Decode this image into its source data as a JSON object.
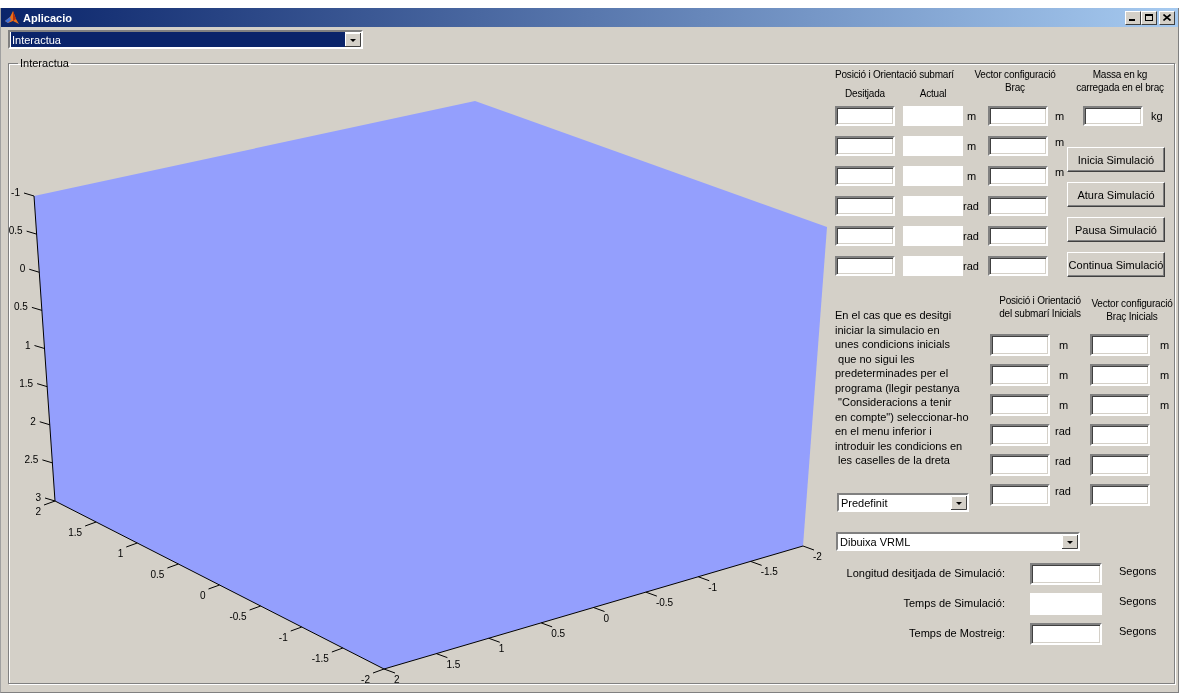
{
  "window": {
    "title": "Aplicacio"
  },
  "mode_select": {
    "value": "Interactua",
    "highlighted": true
  },
  "panel": {
    "title": "Interactua"
  },
  "plot": {
    "z_ticks": [
      "-1",
      "0.5",
      "0",
      "0.5",
      "1",
      "1.5",
      "2",
      "2.5",
      "3"
    ],
    "x_ticks": [
      "2",
      "1.5",
      "1",
      "0.5",
      "0",
      "-0.5",
      "-1",
      "-1.5",
      "-2"
    ],
    "y_ticks": [
      "2",
      "1.5",
      "1",
      "0.5",
      "0",
      "-0.5",
      "-1",
      "-1.5",
      "-2"
    ]
  },
  "target": {
    "title": "Posició i Orientació submarí",
    "columns": [
      {
        "label": "Desitjada",
        "kind": "edit"
      },
      {
        "label": "Actual",
        "kind": "display"
      }
    ],
    "units": [
      "m",
      "m",
      "m",
      "rad",
      "rad",
      "rad"
    ]
  },
  "arm": {
    "title": "Vector configuració\nBraç",
    "units": [
      "m",
      "m",
      "m"
    ]
  },
  "mass": {
    "title": "Massa en kg\ncarregada en el braç",
    "unit": "kg"
  },
  "buttons": [
    "Inicia Simulació",
    "Atura Simulació",
    "Pausa Simulació",
    "Continua Simulació"
  ],
  "initial": {
    "note": "En el cas que es desitgi\niniciar la simulacio en\nunes condicions inicials\n que no sigui les\npredeterminades per el\nprograma (llegir pestanya\n \"Consideracions a tenir\nen compte\") seleccionar-ho\nen el menu inferior i\nintroduir les condicions en\n les caselles de la dreta",
    "position_title": "Posició i Orientació\ndel submarí Inicials",
    "position_units": [
      "m",
      "m",
      "m",
      "rad",
      "rad",
      "rad"
    ],
    "arm_title": "Vector configuració\nBraç Inicials",
    "arm_units": [
      "m",
      "m",
      "m"
    ]
  },
  "preset_select": {
    "value": "Predefinit",
    "highlighted": false
  },
  "draw_select": {
    "value": "Dibuixa VRML",
    "highlighted": false
  },
  "timing": [
    {
      "label": "Longitud desitjada de Simulació:",
      "unit": "Segons",
      "kind": "edit"
    },
    {
      "label": "Temps de Simulació:",
      "unit": "Segons",
      "kind": "display"
    },
    {
      "label": "Temps de Mostreig:",
      "unit": "Segons",
      "kind": "edit"
    }
  ]
}
